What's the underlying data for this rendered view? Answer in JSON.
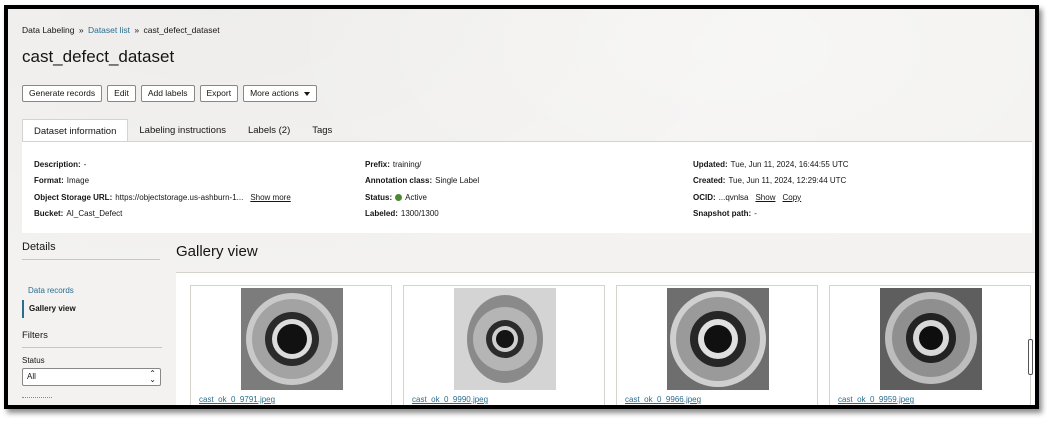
{
  "breadcrumb": {
    "root": "Data Labeling",
    "dataset_list": "Dataset list",
    "current": "cast_defect_dataset",
    "separator": "»"
  },
  "page": {
    "title": "cast_defect_dataset"
  },
  "toolbar": {
    "generate_records": "Generate records",
    "edit": "Edit",
    "add_labels": "Add labels",
    "export": "Export",
    "more_actions": "More actions"
  },
  "tabs": [
    {
      "label": "Dataset information",
      "active": true
    },
    {
      "label": "Labeling instructions",
      "active": false
    },
    {
      "label": "Labels (2)",
      "active": false
    },
    {
      "label": "Tags",
      "active": false
    }
  ],
  "info": {
    "description": {
      "label": "Description:",
      "value": "-"
    },
    "format": {
      "label": "Format:",
      "value": "Image"
    },
    "object_storage_url": {
      "label": "Object Storage URL:",
      "value": "https://objectstorage.us-ashburn-1...",
      "action": "Show more"
    },
    "bucket": {
      "label": "Bucket:",
      "value": "AI_Cast_Defect"
    },
    "prefix": {
      "label": "Prefix:",
      "value": "training/"
    },
    "annotation_class": {
      "label": "Annotation class:",
      "value": "Single Label"
    },
    "status": {
      "label": "Status:",
      "value": "Active",
      "color": "#4b8a2f"
    },
    "labeled": {
      "label": "Labeled:",
      "value": "1300/1300"
    },
    "updated": {
      "label": "Updated:",
      "value": "Tue, Jun 11, 2024, 16:44:55 UTC"
    },
    "created": {
      "label": "Created:",
      "value": "Tue, Jun 11, 2024, 12:29:44 UTC"
    },
    "ocid": {
      "label": "OCID:",
      "value": "...qvnlsa",
      "show": "Show",
      "copy": "Copy"
    },
    "snapshot_path": {
      "label": "Snapshot path:",
      "value": "-"
    }
  },
  "sidebar": {
    "heading": "Details",
    "items": [
      {
        "label": "Data records",
        "active": false
      },
      {
        "label": "Gallery view",
        "active": true
      }
    ],
    "filters": {
      "heading": "Filters",
      "status_label": "Status",
      "status_value": "All"
    }
  },
  "gallery": {
    "title": "Gallery view",
    "items": [
      {
        "filename": "cast_ok_0_9791.jpeg"
      },
      {
        "filename": "cast_ok_0_9990.jpeg"
      },
      {
        "filename": "cast_ok_0_9966.jpeg"
      },
      {
        "filename": "cast_ok_0_9959.jpeg"
      }
    ]
  },
  "colors": {
    "link": "#2a6d8f",
    "active_status": "#4b8a2f",
    "panel_bg": "#f3f2f0"
  }
}
